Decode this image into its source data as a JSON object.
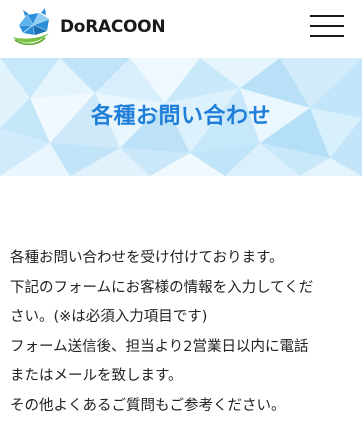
{
  "header": {
    "logo_text": "DoRACOON",
    "logo_icon": "raccoon-leaf-logo",
    "menu_icon": "hamburger-menu-icon"
  },
  "banner": {
    "title": "各種お問い合わせ"
  },
  "intro": {
    "lines": [
      "各種お問い合わせを受け付けております。",
      "下記のフォームにお客様の情報を入力してくだ",
      "さい。(※は必須入力項目です)",
      "フォーム送信後、担当より2営業日以内に電話",
      "またはメールを致します。",
      "その他よくあるご質問もご参考ください。"
    ]
  },
  "colors": {
    "accent": "#1f7fd8",
    "banner_light": "#e8f5fd",
    "banner_mid": "#bfe3f8",
    "logo_green": "#7cc242",
    "logo_blue": "#2a8fd8"
  }
}
